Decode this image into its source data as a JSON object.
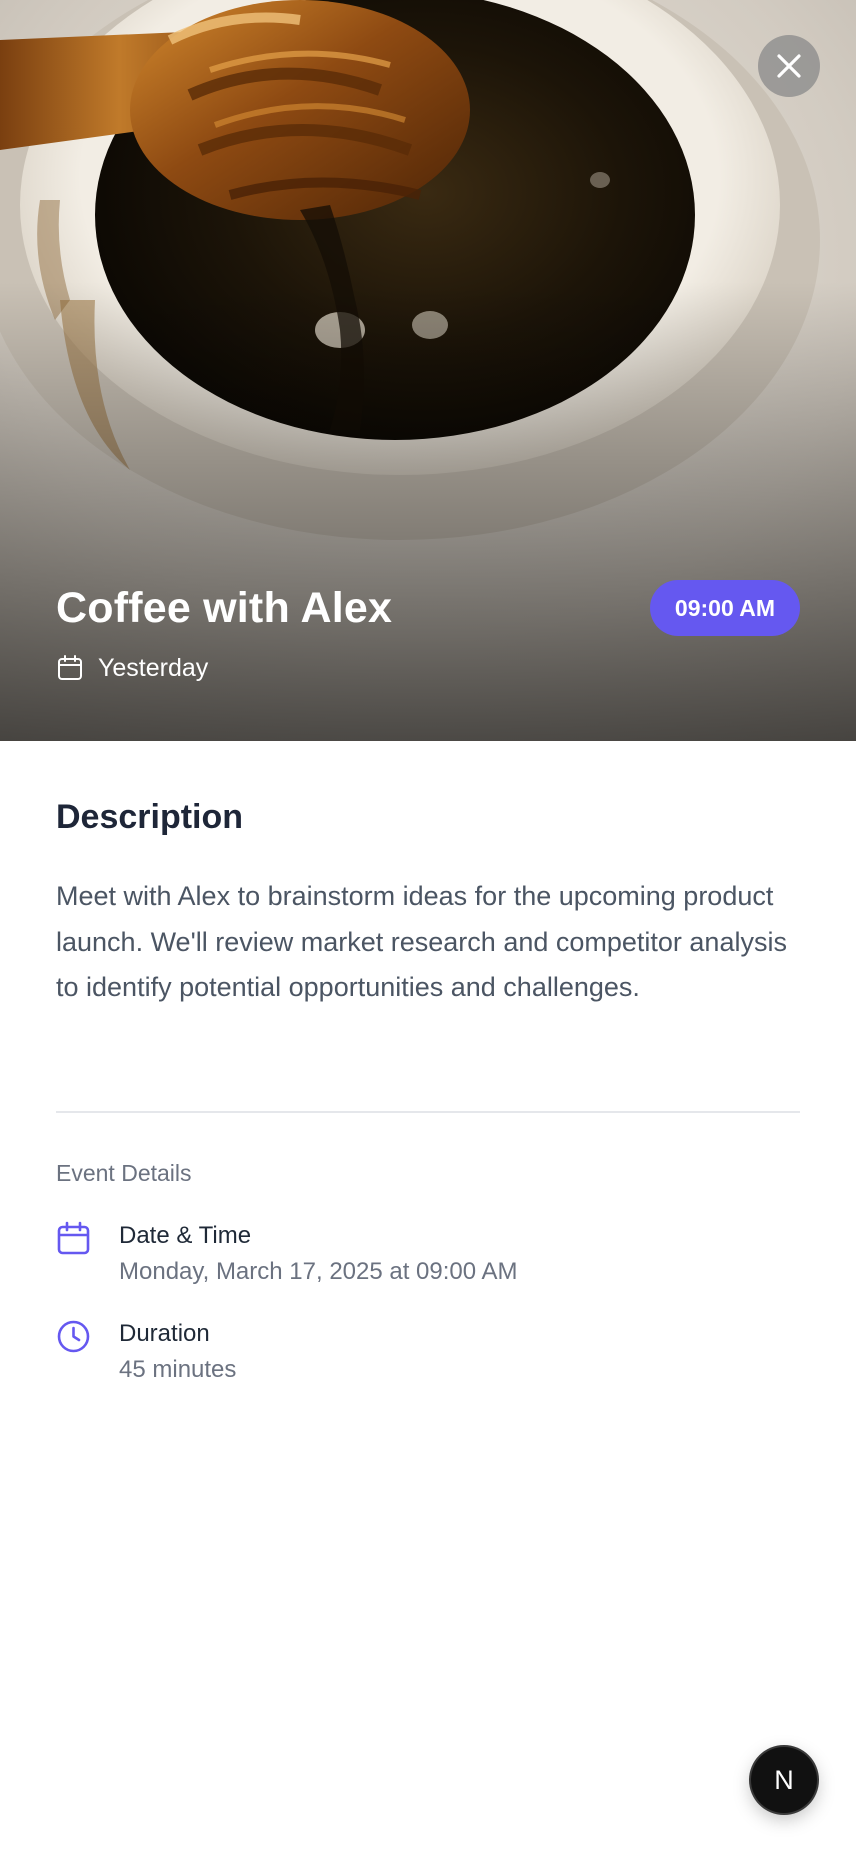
{
  "event": {
    "title": "Coffee with Alex",
    "time_badge": "09:00 AM",
    "relative_date": "Yesterday"
  },
  "description": {
    "heading": "Description",
    "text": "Meet with Alex to brainstorm ideas for the upcoming product launch. We'll review market research and competitor analysis to identify potential opportunities and challenges."
  },
  "details": {
    "section_label": "Event Details",
    "datetime": {
      "label": "Date & Time",
      "value": "Monday, March 17, 2025 at 09:00 AM"
    },
    "duration": {
      "label": "Duration",
      "value": "45 minutes"
    }
  },
  "floating_button": {
    "label": "N"
  },
  "icons": {
    "close": "close-icon",
    "hero_date": "calendar-icon",
    "datetime": "calendar-icon",
    "duration": "clock-icon"
  },
  "colors": {
    "accent": "#6558f0",
    "heading": "#1e2638",
    "body_text": "#4b5563",
    "muted_text": "#6b7280",
    "divider": "#e5e7eb"
  }
}
